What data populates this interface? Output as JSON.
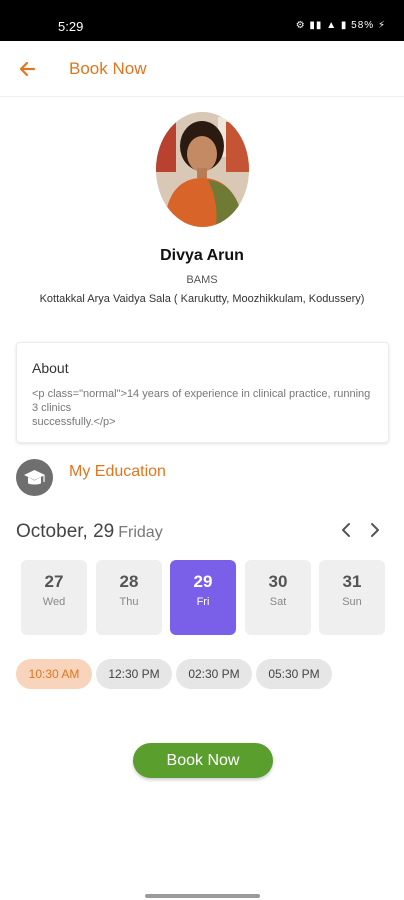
{
  "status_bar": {
    "time": "5:29",
    "icons_text": "⚙ ▮▮ ▲ ▮ 58% ⚡"
  },
  "app_bar": {
    "title": "Book Now",
    "back_icon": "arrow-left-icon"
  },
  "doctor": {
    "name": "Divya Arun",
    "degree": "BAMS",
    "clinic": "Kottakkal Arya Vaidya Sala ( Karukutty, Moozhikkulam, Kodussery)"
  },
  "about": {
    "title": "About",
    "text": "<p class=\"normal\">14 years of experience in clinical practice, running 3 clinics\nsuccessfully.</p>"
  },
  "education": {
    "label": "My Education",
    "icon": "graduation-cap-icon"
  },
  "calendar": {
    "month_day": "October, 29",
    "weekday": "Friday",
    "days": [
      {
        "num": "27",
        "name": "Wed",
        "selected": false
      },
      {
        "num": "28",
        "name": "Thu",
        "selected": false
      },
      {
        "num": "29",
        "name": "Fri",
        "selected": true
      },
      {
        "num": "30",
        "name": "Sat",
        "selected": false
      },
      {
        "num": "31",
        "name": "Sun",
        "selected": false
      }
    ]
  },
  "time_slots": [
    {
      "label": "10:30 AM",
      "selected": true
    },
    {
      "label": "12:30 PM",
      "selected": false
    },
    {
      "label": "02:30 PM",
      "selected": false
    },
    {
      "label": "05:30 PM",
      "selected": false
    }
  ],
  "book_button": {
    "label": "Book Now"
  },
  "colors": {
    "accent_orange": "#e0761f",
    "selected_day": "#7a60e8",
    "book_green": "#5a9e2e",
    "slot_selected_bg": "#f8d4bd"
  }
}
